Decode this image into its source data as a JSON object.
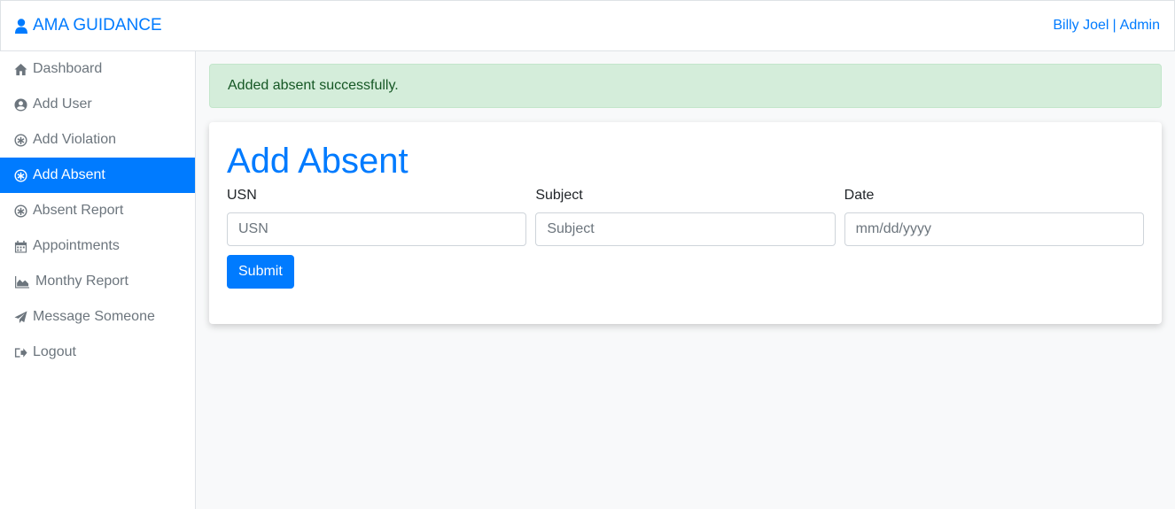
{
  "navbar": {
    "brand": "AMA GUIDANCE",
    "user_name": "Billy Joel",
    "separator": "|",
    "role_link": "Admin"
  },
  "sidebar": {
    "items": [
      {
        "label": "Dashboard",
        "icon": "home-icon"
      },
      {
        "label": "Add User",
        "icon": "user-circle-icon"
      },
      {
        "label": "Add Violation",
        "icon": "asterisk-circle-icon"
      },
      {
        "label": "Add Absent",
        "icon": "asterisk-circle-icon",
        "active": true
      },
      {
        "label": "Absent Report",
        "icon": "asterisk-circle-icon"
      },
      {
        "label": "Appointments",
        "icon": "calendar-icon"
      },
      {
        "label": "Monthy Report",
        "icon": "area-chart-icon"
      },
      {
        "label": "Message Someone",
        "icon": "paper-plane-icon"
      },
      {
        "label": "Logout",
        "icon": "sign-out-icon"
      }
    ]
  },
  "alert": {
    "message": "Added absent successfully."
  },
  "form": {
    "title": "Add Absent",
    "fields": [
      {
        "label": "USN",
        "placeholder": "USN",
        "value": ""
      },
      {
        "label": "Subject",
        "placeholder": "Subject",
        "value": ""
      },
      {
        "label": "Date",
        "placeholder": "mm/dd/yyyy",
        "value": ""
      }
    ],
    "submit_label": "Submit"
  },
  "colors": {
    "primary": "#007bff",
    "success_bg": "#d4edda",
    "success_text": "#155724"
  }
}
